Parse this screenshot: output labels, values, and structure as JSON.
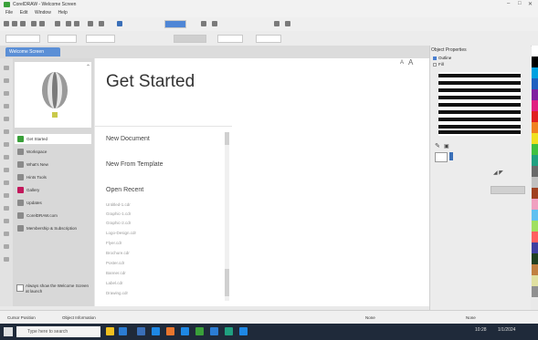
{
  "titlebar": {
    "title": "CorelDRAW - Welcome Screen",
    "controls": [
      "–",
      "□",
      "✕"
    ]
  },
  "menu": {
    "items": [
      "File",
      "Edit",
      "Window",
      "Help"
    ]
  },
  "doc_tab": {
    "label": "Welcome Screen"
  },
  "start_nav": {
    "items": [
      {
        "label": "Get Started",
        "color": "#3aa03a",
        "selected": true
      },
      {
        "label": "Workspace",
        "color": "#8a8a8a"
      },
      {
        "label": "What's New",
        "color": "#8a8a8a"
      },
      {
        "label": "Hints Tools",
        "color": "#8a8a8a"
      },
      {
        "label": "Gallery",
        "color": "#c2185b"
      },
      {
        "label": "Updates",
        "color": "#8a8a8a"
      },
      {
        "label": "CorelDRAW.com",
        "color": "#8a8a8a"
      },
      {
        "label": "Membership & Subscription",
        "color": "#8a8a8a"
      }
    ],
    "footer_checkbox": "Always show the Welcome Screen at launch"
  },
  "content": {
    "title": "Get Started",
    "new_document": "New Document",
    "new_from_template": "New From Template",
    "open_recent": "Open Recent",
    "recent_files": [
      "Untitled-1.cdr",
      "Graphic-1.cdr",
      "Graphic-2.cdr",
      "Logo-Design.cdr",
      "Flyer.cdr",
      "Brochure.cdr",
      "Poster.cdr",
      "Banner.cdr",
      "Label.cdr",
      "Drawing.cdr"
    ]
  },
  "docker": {
    "title": "Object Properties",
    "row1": "Outline",
    "row2": "Fill"
  },
  "status": {
    "left": "Cursor Position",
    "mid": "Object Information",
    "fill": "None",
    "outline": "None"
  },
  "taskbar": {
    "search_placeholder": "Type here to search",
    "time": "10:28",
    "date": "1/1/2024"
  },
  "palette_colors": [
    "#ffffff",
    "#000000",
    "#00a0e0",
    "#2060c0",
    "#8020a0",
    "#e02080",
    "#e02020",
    "#f08020",
    "#f0e020",
    "#40c040",
    "#20a080",
    "#6a6a6a",
    "#c0c0c0",
    "#a04020",
    "#f0a0c0",
    "#60c0f0",
    "#a0e060",
    "#ff6060",
    "#4040a0",
    "#204020",
    "#c08040",
    "#e0e0a0",
    "#909090"
  ]
}
